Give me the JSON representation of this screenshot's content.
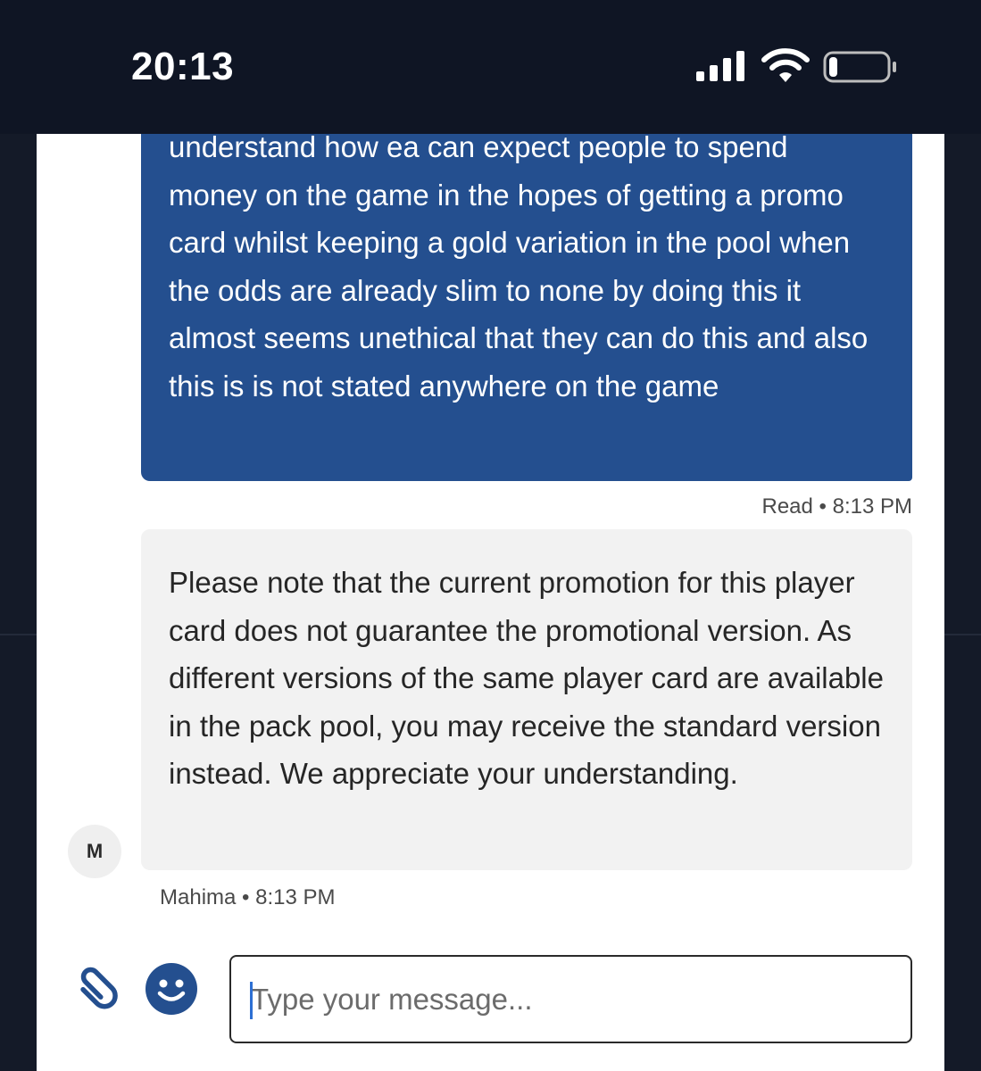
{
  "status_bar": {
    "time": "20:13",
    "icons": [
      "signal-icon",
      "wifi-icon",
      "battery-icon"
    ],
    "battery_level": 0.15
  },
  "messages": [
    {
      "direction": "outgoing",
      "text": "understand how ea can expect people to spend money on the game in the hopes of getting a promo card whilst keeping a gold variation in the pool when the odds are already slim to none by doing this it almost seems unethical that they can do this and also this is is not stated anywhere on the game",
      "meta": "Read • 8:13 PM"
    },
    {
      "direction": "incoming",
      "avatar_initial": "M",
      "text": "Please note that the current promotion for this player card does not guarantee the promotional version. As different versions of the same player card are available in the pack pool, you may receive the standard version instead. We appreciate your understanding.",
      "meta": "Mahima • 8:13 PM"
    }
  ],
  "composer": {
    "placeholder": "Type your message...",
    "value": "",
    "icons": [
      "paperclip-icon",
      "smiley-icon"
    ]
  },
  "colors": {
    "outgoing_bubble": "#244f8f",
    "incoming_bubble": "#f2f2f2",
    "accent": "#244f8f",
    "status_bar": "#0f1524"
  }
}
